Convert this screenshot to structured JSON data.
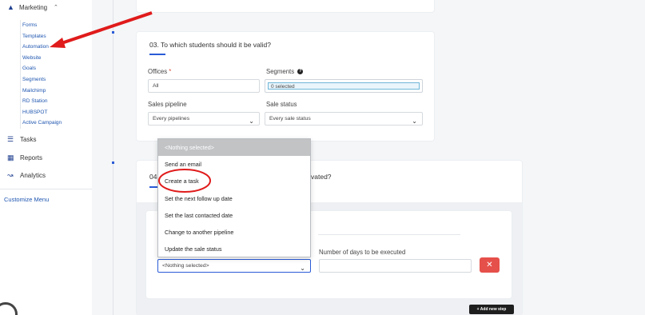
{
  "sidebar": {
    "marketing": {
      "label": "Marketing",
      "icon": "marketing-icon"
    },
    "submenu": [
      "Forms",
      "Templates",
      "Automation",
      "Website",
      "Goals",
      "Segments",
      "Mailchimp",
      "RD Station",
      "HUBSPOT",
      "Active Campaign"
    ],
    "tasks": "Tasks",
    "reports": "Reports",
    "analytics": "Analytics",
    "customize": "Customize Menu"
  },
  "section3": {
    "title": "03. To which students should it be valid?",
    "offices_label": "Offices",
    "offices_required": "*",
    "offices_value": "All",
    "segments_label": "Segments",
    "segments_value": "0 selected",
    "pipeline_label": "Sales pipeline",
    "pipeline_value": "Every pipelines",
    "status_label": "Sale status",
    "status_value": "Every sale status"
  },
  "section4": {
    "title_prefix": "04.",
    "title_suffix": "vated?"
  },
  "step": {
    "action_value": "<Nothing selected>",
    "days_label": "Number of days to be executed",
    "days_value": "",
    "remove_symbol": "✕",
    "add_step": "+ Add new step"
  },
  "dropdown": {
    "options": [
      "<Nothing selected>",
      "Send an email",
      "Create a task",
      "Set the next follow up date",
      "Set the last contacted date",
      "Change to another pipeline",
      "Update the sale status"
    ],
    "selected_index": 0,
    "highlighted": "Create a task"
  },
  "colors": {
    "accent": "#2a5bd7",
    "annotation": "#e01b1b",
    "danger": "#e6504a"
  }
}
